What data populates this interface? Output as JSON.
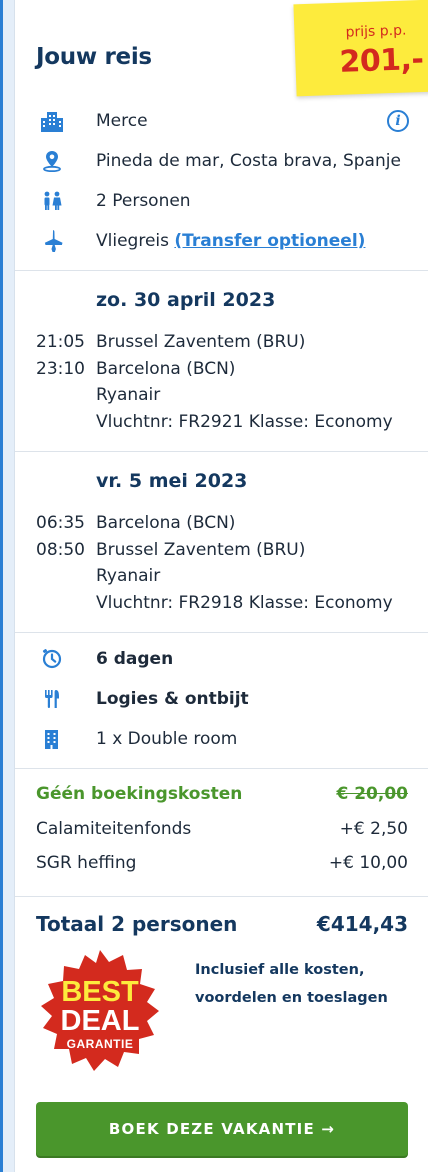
{
  "header": {
    "title": "Jouw reis"
  },
  "price_note": {
    "label": "prijs p.p.",
    "price": "201,-"
  },
  "details": {
    "hotel": "Merce",
    "location": "Pineda de mar, Costa brava, Spanje",
    "persons": "2 Personen",
    "travel_type": "Vliegreis",
    "transfer_link": "(Transfer optioneel)"
  },
  "outbound": {
    "date": "zo. 30 april 2023",
    "depart_time": "21:05",
    "depart_airport": "Brussel Zaventem (BRU)",
    "arrive_time": "23:10",
    "arrive_airport": "Barcelona (BCN)",
    "airline": "Ryanair",
    "flight_info": "Vluchtnr: FR2921 Klasse: Economy"
  },
  "return": {
    "date": "vr. 5 mei 2023",
    "depart_time": "06:35",
    "depart_airport": "Barcelona (BCN)",
    "arrive_time": "08:50",
    "arrive_airport": "Brussel Zaventem (BRU)",
    "airline": "Ryanair",
    "flight_info": "Vluchtnr: FR2918 Klasse: Economy"
  },
  "stay": {
    "duration": "6 dagen",
    "board": "Logies & ontbijt",
    "room": "1 x Double room"
  },
  "costs": {
    "booking_label": "Géén boekingskosten",
    "booking_value": "€ 20,00",
    "fund_label": "Calamiteitenfonds",
    "fund_value": "+€ 2,50",
    "sgr_label": "SGR heffing",
    "sgr_value": "+€ 10,00"
  },
  "total": {
    "label": "Totaal 2 personen",
    "value": "€414,43"
  },
  "inclusive": {
    "line1": "Inclusief alle kosten,",
    "line2": "voordelen en toeslagen"
  },
  "badge": {
    "line1": "BEST",
    "line2": "DEAL",
    "line3": "GARANTIE"
  },
  "cta": {
    "label": "BOEK DEZE VAKANTIE →"
  },
  "colors": {
    "accent": "#2a7fd4",
    "heading": "#14385f",
    "green": "#4a962c",
    "sticky": "#fdeb3d",
    "red": "#d32a1e"
  }
}
